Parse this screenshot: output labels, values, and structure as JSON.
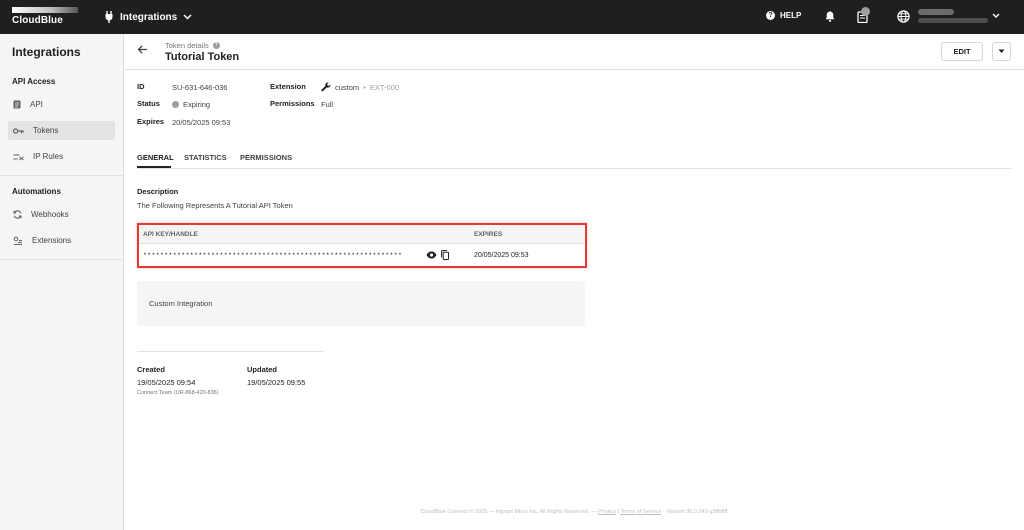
{
  "topbar": {
    "brand": "CloudBlue",
    "module": "Integrations",
    "help_label": "HELP"
  },
  "sidebar": {
    "title": "Integrations",
    "sections": [
      {
        "label": "API Access",
        "items": [
          {
            "label": "API",
            "icon": "document-icon",
            "active": false
          },
          {
            "label": "Tokens",
            "icon": "key-icon",
            "active": true
          },
          {
            "label": "IP Rules",
            "icon": "ip-rules-icon",
            "active": false
          }
        ]
      },
      {
        "label": "Automations",
        "items": [
          {
            "label": "Webhooks",
            "icon": "webhook-icon",
            "active": false
          },
          {
            "label": "Extensions",
            "icon": "extensions-icon",
            "active": false
          }
        ]
      }
    ]
  },
  "header": {
    "breadcrumb": "Token details",
    "title": "Tutorial Token",
    "edit_label": "EDIT"
  },
  "details": {
    "id_label": "ID",
    "id_value": "SU-631-646-036",
    "status_label": "Status",
    "status_value": "Expiring",
    "expires_label": "Expires",
    "expires_value": "20/05/2025 09:53",
    "extension_label": "Extension",
    "extension_name": "custom",
    "extension_sep": "•",
    "extension_id": "EXT-000",
    "permissions_label": "Permissions",
    "permissions_value": "Full"
  },
  "tabs": [
    {
      "label": "GENERAL",
      "active": true
    },
    {
      "label": "STATISTICS",
      "active": false
    },
    {
      "label": "PERMISSIONS",
      "active": false
    }
  ],
  "description": {
    "label": "Description",
    "value": "The Following Represents A Tutorial API Token"
  },
  "api_table": {
    "col_key": "API KEY/HANDLE",
    "col_expires": "EXPIRES",
    "key_masked": "*************************************************************",
    "expires": "20/05/2025 09:53"
  },
  "integration_box": {
    "label": "Custom Integration"
  },
  "meta": {
    "created_label": "Created",
    "created_value": "19/05/2025 09:54",
    "created_by": "Connect Team (UR-868-420-836)",
    "updated_label": "Updated",
    "updated_value": "19/05/2025 09:55"
  },
  "footer": {
    "text": "CloudBlue Connect © 2025 — Ingram Micro Inc. All Rights Reserved. —",
    "privacy": "Privacy",
    "divider": "|",
    "terms": "Terms of Service",
    "version": "- Version 36.0.243-g3ffb8ff"
  }
}
